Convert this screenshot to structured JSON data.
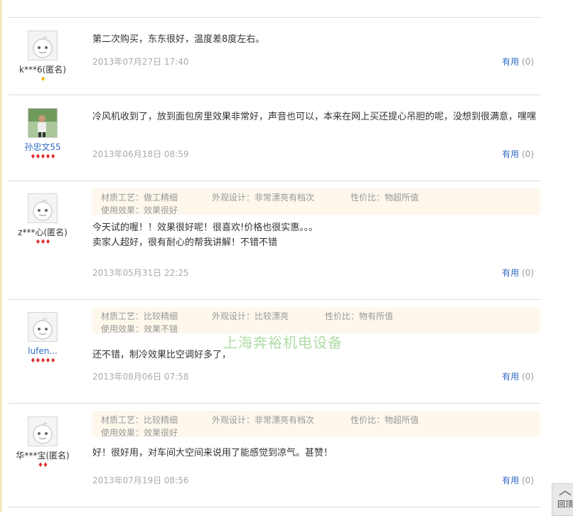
{
  "useful_label": "有用",
  "useful_count": "(0)",
  "watermark": "上海奔裕机电设备",
  "backtop_label": "回顶",
  "reviews": [
    {
      "user": "k***6(匿名)",
      "gems": "♦",
      "text": "第二次购买，东东很好，温度差8度左右。",
      "date": "2013年07月27日 17:40"
    },
    {
      "user": "孙忠文55",
      "gems": "♦♦♦♦♦",
      "text": "冷风机收到了，放到面包房里效果非常好，声音也可以，本来在网上买还提心吊胆的呢，没想到很满意，嘿嘿",
      "date": "2013年06月18日 08:59"
    },
    {
      "user": "z***心(匿名)",
      "gems": "♦♦♦",
      "attrs": [
        "材质工艺：做工精细",
        "外观设计：非常漂亮有档次",
        "性价比：物超所值",
        "使用效果：效果很好"
      ],
      "text_lines": [
        "今天试的喔！！效果很好呢！很喜欢!价格也很实惠。。。",
        "卖家人超好，很有耐心的帮我讲解！不错不错"
      ],
      "date": "2013年05月31日 22:25"
    },
    {
      "user": "lufen...",
      "gems": "♦♦♦♦♦",
      "attrs": [
        "材质工艺：比较精细",
        "外观设计：比较漂亮",
        "性价比：物有所值",
        "使用效果：效果不错"
      ],
      "text": "还不错，制冷效果比空调好多了，",
      "date": "2013年08月06日 07:58"
    },
    {
      "user": "华***宝(匿名)",
      "gems": "♦♦",
      "attrs": [
        "材质工艺：比较精细",
        "外观设计：非常漂亮有档次",
        "性价比：物超所值",
        "使用效果：效果很好"
      ],
      "text": "好！很好用，对车间大空间来说用了能感觉到凉气。甚赞！",
      "date": "2013年07月19日 08:56"
    }
  ]
}
